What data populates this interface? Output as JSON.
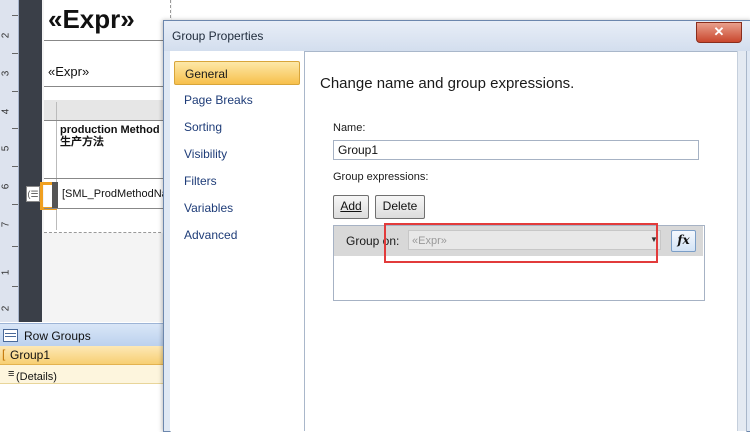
{
  "designer": {
    "expr_large": "«Expr»",
    "expr_small": "«Expr»",
    "ruler_numbers": [
      "2",
      "3",
      "4",
      "5",
      "6",
      "7",
      "1",
      "2"
    ],
    "col_header_text": "production Method\n生产方法",
    "detail_text": "[SML_ProdMethodNam",
    "row_groups_label": "Row Groups",
    "groups": [
      {
        "label": "Group1"
      },
      {
        "label": "(Details)"
      }
    ]
  },
  "dialog": {
    "title": "Group Properties",
    "close_label": "✕",
    "nav": [
      {
        "label": "General",
        "active": true
      },
      {
        "label": "Page Breaks"
      },
      {
        "label": "Sorting"
      },
      {
        "label": "Visibility"
      },
      {
        "label": "Filters"
      },
      {
        "label": "Variables"
      },
      {
        "label": "Advanced"
      }
    ],
    "heading": "Change name and group expressions.",
    "name_label": "Name:",
    "name_value": "Group1",
    "group_expressions_label": "Group expressions:",
    "add_label": "Add",
    "delete_label": "Delete",
    "group_on_label": "Group on:",
    "group_on_placeholder": "«Expr»",
    "fx_label": "fx"
  },
  "colors": {
    "highlight_box": "#e23b3b",
    "active_nav": "#f7c04c"
  }
}
